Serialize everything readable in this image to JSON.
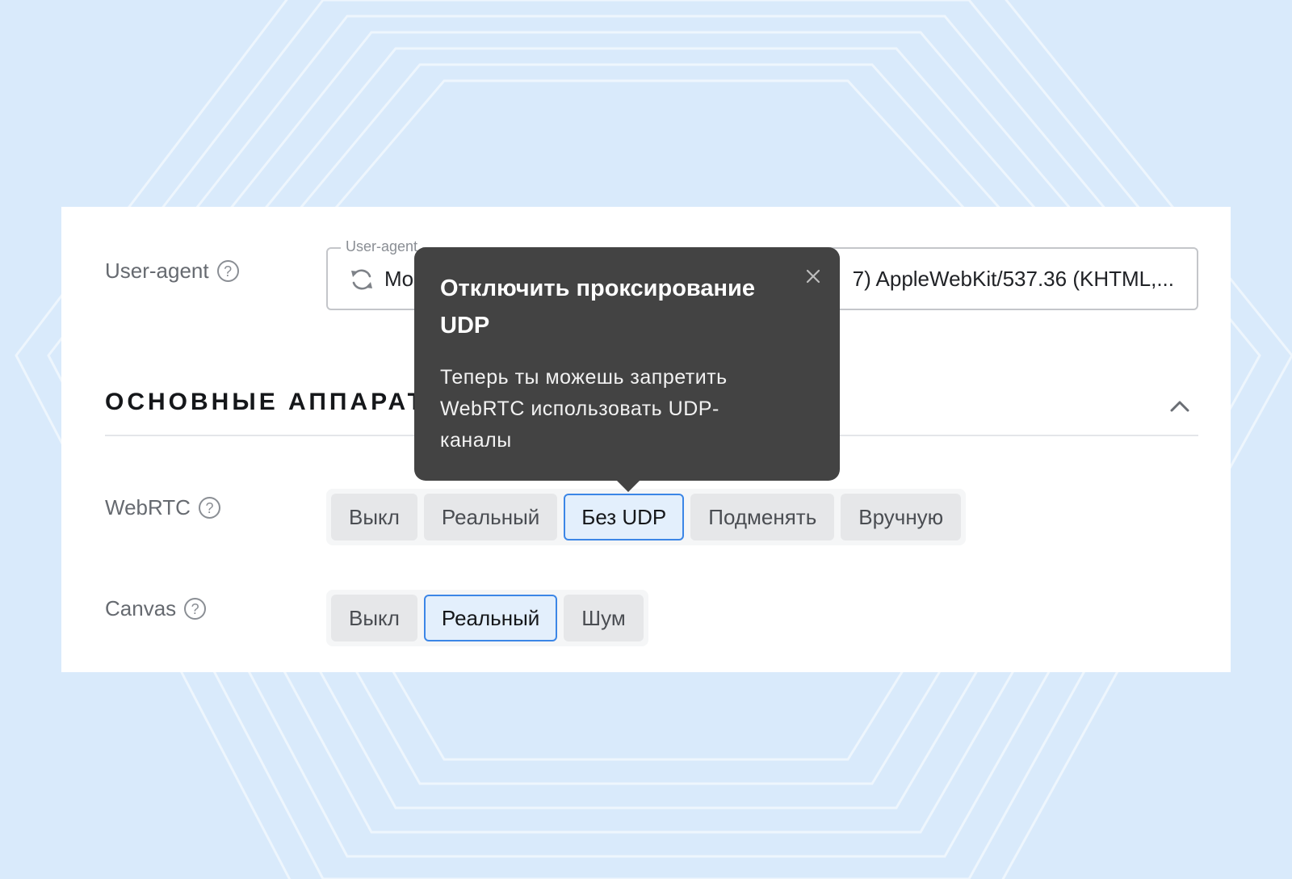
{
  "user_agent": {
    "label": "User-agent",
    "legend": "User-agent",
    "value_visible_start": "Mo",
    "value_visible_end": "7) AppleWebKit/537.36 (KHTML,..."
  },
  "section": {
    "title": "ОСНОВНЫЕ АППАРАТН"
  },
  "webrtc": {
    "label": "WebRTC",
    "options": [
      "Выкл",
      "Реальный",
      "Без UDP",
      "Подменять",
      "Вручную"
    ],
    "selected": "Без UDP"
  },
  "canvas": {
    "label": "Canvas",
    "options": [
      "Выкл",
      "Реальный",
      "Шум"
    ],
    "selected": "Реальный"
  },
  "tooltip": {
    "title": "Отключить проксирование UDP",
    "body": "Теперь ты можешь запретить WebRTC использовать UDP-каналы"
  },
  "icons": {
    "help": "question-circle-icon",
    "refresh": "refresh-icon",
    "collapse": "chevron-up-icon",
    "close": "close-icon"
  },
  "colors": {
    "background": "#d9eafb",
    "accent": "#3c86e6",
    "tooltip": "#434343"
  }
}
